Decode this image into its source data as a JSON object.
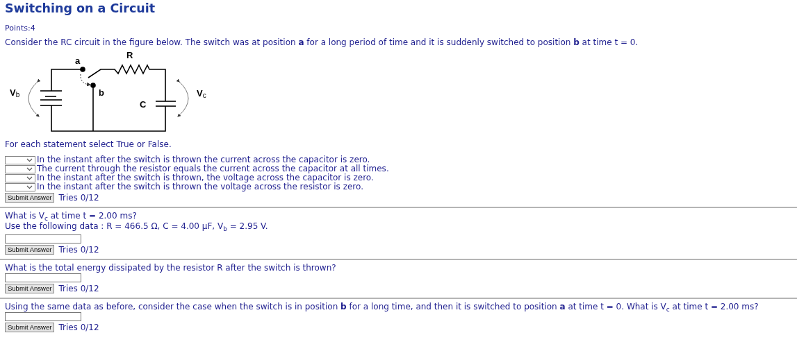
{
  "title": "Switching on a Circuit",
  "points": "Points:4",
  "intro": "Consider the RC circuit in the figure below. The switch was at position **a** for a long period of time and it is suddenly switched to position **b** at time t = 0.",
  "figure": {
    "switch_a": "a",
    "switch_b": "b",
    "resistor": "R",
    "capacitor": "C",
    "battery_voltage": "V$_{b}$",
    "capacitor_voltage": "V$_{c}$"
  },
  "instruction": "For each statement select True or False.",
  "parts": [
    {
      "kind": "select",
      "statements": [
        "In the instant after the switch is thrown the current across the capacitor is zero.",
        "The current through the resistor equals the current across the capacitor at all times.",
        "In the instant after the switch is thrown, the voltage across the capacitor is zero.",
        "In the instant after the switch is thrown the voltage across the resistor is zero."
      ],
      "submit": "Submit Answer",
      "tries": "Tries 0/12"
    },
    {
      "kind": "numeric",
      "question": "What is V$_{c}$ at time t = 2.00 ms?",
      "data": "Use the following data : R = 466.5 Ω, C = 4.00 μF, V$_{b}$ = 2.95 V.",
      "submit": "Submit Answer",
      "tries": "Tries 0/12"
    },
    {
      "kind": "numeric",
      "question": "What is the total energy dissipated by the resistor R after the switch is thrown?",
      "submit": "Submit Answer",
      "tries": "Tries 0/12"
    },
    {
      "kind": "numeric",
      "question": "Using the same data as before, consider the case when the switch is in position **b** for a long time, and then it is switched to position **a** at time t = 0. What is V$_{c}$ at time t = 2.00 ms?",
      "submit": "Submit Answer",
      "tries": "Tries 0/12"
    }
  ]
}
